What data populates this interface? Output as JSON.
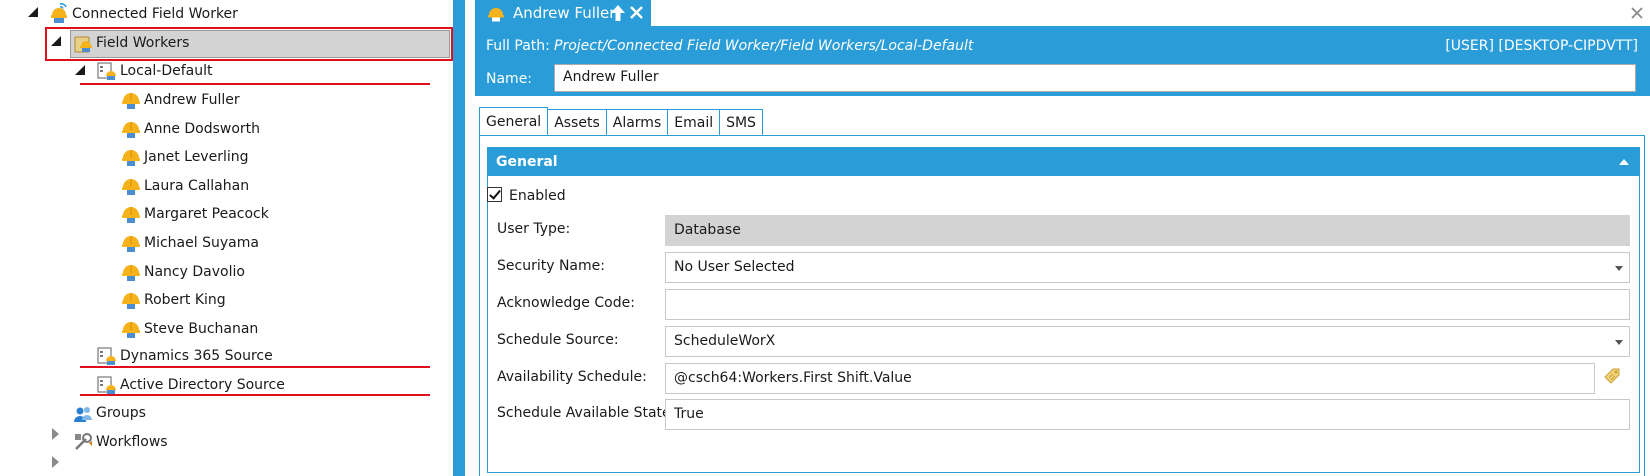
{
  "tree": {
    "root_label": "Connected Field Worker",
    "field_workers_label": "Field Workers",
    "local_default_label": "Local-Default",
    "workers": [
      "Andrew Fuller",
      "Anne Dodsworth",
      "Janet Leverling",
      "Laura Callahan",
      "Margaret Peacock",
      "Michael Suyama",
      "Nancy Davolio",
      "Robert King",
      "Steve Buchanan"
    ],
    "dynamics_label": "Dynamics 365 Source",
    "active_directory_label": "Active Directory Source",
    "groups_label": "Groups",
    "workflows_label": "Workflows"
  },
  "doc_tab": {
    "title": "Andrew Fuller"
  },
  "header": {
    "full_path_label": "Full Path:",
    "full_path_value": "Project/Connected Field Worker/Field Workers/Local-Default",
    "user_info": "[USER] [DESKTOP-CIPDVTT]",
    "name_label": "Name:",
    "name_value": "Andrew Fuller"
  },
  "tabs": [
    "General",
    "Assets",
    "Alarms",
    "Email",
    "SMS"
  ],
  "general": {
    "title": "General",
    "enabled_label": "Enabled",
    "enabled": true,
    "user_type_label": "User Type:",
    "user_type_value": "Database",
    "security_name_label": "Security Name:",
    "security_name_value": "No User Selected",
    "ack_code_label": "Acknowledge Code:",
    "ack_code_value": "",
    "schedule_source_label": "Schedule Source:",
    "schedule_source_value": "ScheduleWorX",
    "availability_label": "Availability Schedule:",
    "availability_value": "@csch64:Workers.First Shift.Value",
    "available_state_label": "Schedule Available State:",
    "available_state_value": "True"
  },
  "colors": {
    "accent": "#2a9cd8",
    "highlight": "#e0101a"
  },
  "icons": {
    "worker": "worker-helmet-icon",
    "folder": "folder-worker-icon",
    "source": "source-icon",
    "groups": "groups-icon",
    "workflows": "workflows-icon"
  }
}
